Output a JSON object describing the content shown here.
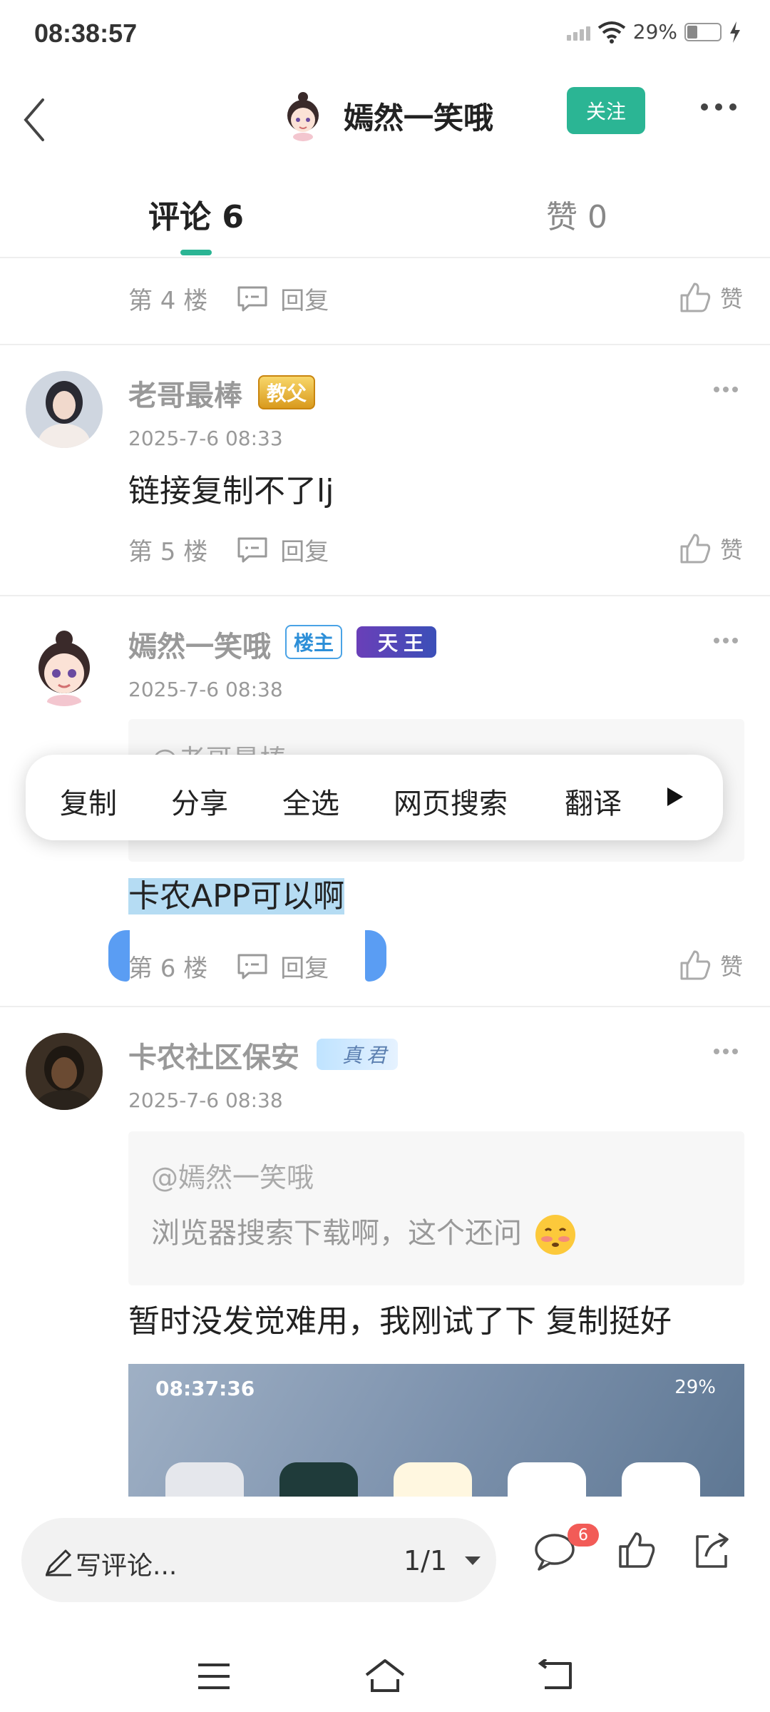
{
  "status_bar": {
    "time": "08:38:57",
    "battery_percent": "29%"
  },
  "header": {
    "title": "嫣然一笑哦",
    "follow_label": "关注"
  },
  "tabs": {
    "comments_label": "评论 6",
    "likes_label": "赞 0"
  },
  "floor_prefix_4": "第 4 楼",
  "reply_label": "回复",
  "like_label": "赞",
  "comments": [
    {
      "user": "老哥最棒",
      "badge": "教父",
      "time": "2025-7-6 08:33",
      "text": "链接复制不了lj",
      "floor": "第 5 楼"
    },
    {
      "user": "嫣然一笑哦",
      "owner_badge": "楼主",
      "badge": "天王",
      "time": "2025-7-6 08:38",
      "quote_user": "@老哥最棒",
      "text": "卡农APP可以啊",
      "floor": "第 6 楼"
    },
    {
      "user": "卡农社区保安",
      "badge": "真君",
      "time": "2025-7-6 08:38",
      "quote_user": "@嫣然一笑哦",
      "quote_text": "浏览器搜索下载啊，这个还问",
      "text": "暂时没发觉难用，我刚试了下 复制挺好"
    }
  ],
  "context_menu": {
    "items": [
      "复制",
      "分享",
      "全选",
      "网页搜索",
      "翻译"
    ]
  },
  "preview": {
    "time": "08:37:36",
    "status": "29%"
  },
  "bottom_bar": {
    "placeholder": "写评论...",
    "pager": "1/1",
    "comment_count": "6"
  },
  "colors": {
    "accent": "#2bb594",
    "selection": "#b5dcf3",
    "handle": "#5a9df3",
    "badge_red": "#f25b57"
  }
}
